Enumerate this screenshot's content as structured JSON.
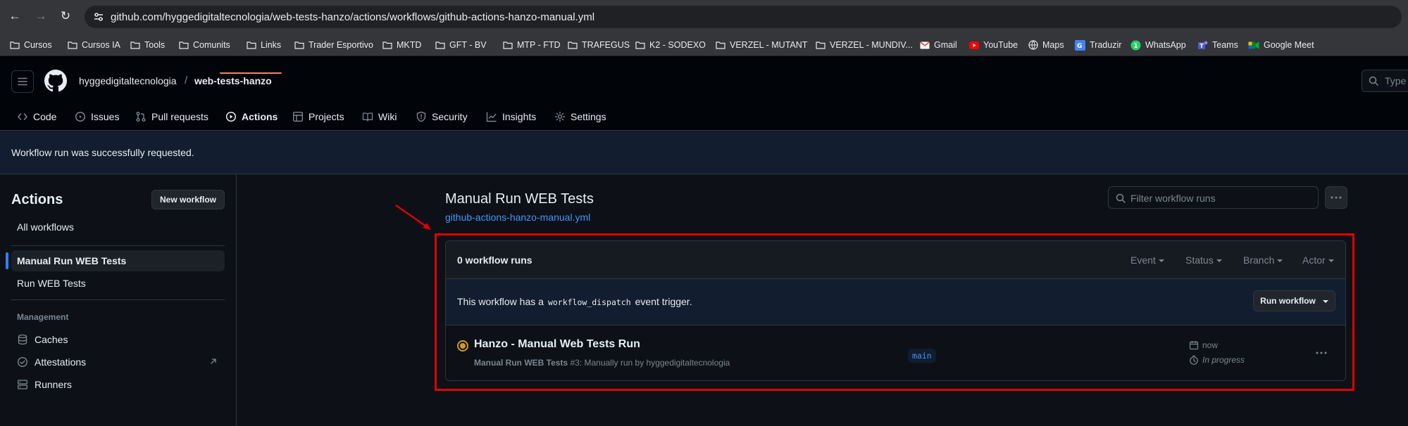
{
  "browser": {
    "url": "github.com/hyggedigitaltecnologia/web-tests-hanzo/actions/workflows/github-actions-hanzo-manual.yml",
    "bookmarks": [
      "Cursos",
      "Cursos IA",
      "Tools",
      "Comunits",
      "Links",
      "Trader Esportivo",
      "MKTD",
      "GFT - BV",
      "MTP - FTD",
      "TRAFEGUS",
      "K2 - SODEXO",
      "VERZEL - MUTANT",
      "VERZEL - MUNDIV...",
      "Gmail",
      "YouTube",
      "Maps",
      "Traduzir",
      "WhatsApp",
      "Teams",
      "Google Meet"
    ],
    "whatsapp_badge": "1"
  },
  "header": {
    "owner": "hyggedigitaltecnologia",
    "separator": "/",
    "repo": "web-tests-hanzo",
    "search_placeholder": "Type"
  },
  "tabs": [
    "Code",
    "Issues",
    "Pull requests",
    "Actions",
    "Projects",
    "Wiki",
    "Security",
    "Insights",
    "Settings"
  ],
  "flash": {
    "message": "Workflow run was successfully requested."
  },
  "sidebar": {
    "title": "Actions",
    "new_workflow": "New workflow",
    "all_workflows": "All workflows",
    "workflows": [
      "Manual Run WEB Tests",
      "Run WEB Tests"
    ],
    "management_heading": "Management",
    "management": [
      "Caches",
      "Attestations",
      "Runners"
    ]
  },
  "main": {
    "workflow_title": "Manual Run WEB Tests",
    "workflow_file": "github-actions-hanzo-manual.yml",
    "filter_placeholder": "Filter workflow runs",
    "runs_count": "0 workflow runs",
    "filters": [
      "Event",
      "Status",
      "Branch",
      "Actor"
    ],
    "dispatch_prefix": "This workflow has a",
    "dispatch_code": "workflow_dispatch",
    "dispatch_suffix": "event trigger.",
    "run_workflow": "Run workflow",
    "run": {
      "title": "Hanzo - Manual Web Tests Run",
      "meta_workflow": "Manual Run WEB Tests",
      "meta_rest": "#3: Manually run by hyggedigitaltecnologia",
      "branch": "main",
      "when": "now",
      "status": "In progress"
    }
  },
  "colors": {
    "accent": "#2f81f7",
    "link": "#4493f8",
    "in_progress": "#d29922",
    "tab_underline": "#f78166",
    "annotation": "#e00000"
  }
}
